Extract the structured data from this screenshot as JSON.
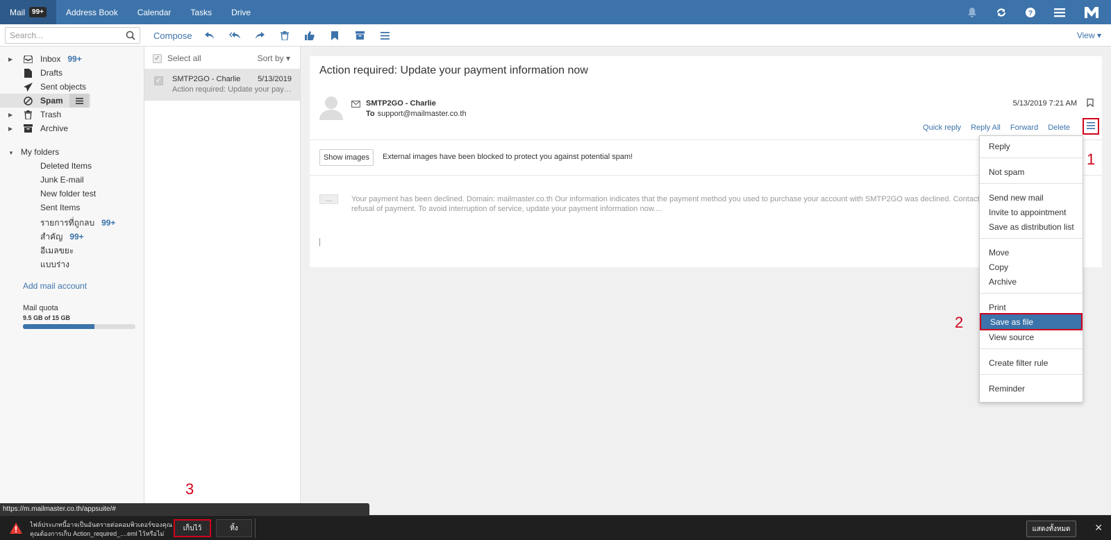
{
  "topbar": {
    "apps": [
      {
        "label": "Mail",
        "badge": "99+",
        "active": true
      },
      {
        "label": "Address Book"
      },
      {
        "label": "Calendar"
      },
      {
        "label": "Tasks"
      },
      {
        "label": "Drive"
      }
    ],
    "icons": [
      "bell-icon",
      "refresh-icon",
      "help-icon",
      "menu-icon",
      "logo-icon"
    ]
  },
  "toolbar": {
    "search_placeholder": "Search...",
    "compose": "Compose",
    "icons": [
      "reply-icon",
      "reply-all-icon",
      "forward-icon",
      "delete-icon",
      "thumbs-up-icon",
      "flag-icon",
      "archive-icon",
      "more-icon"
    ],
    "view": "View"
  },
  "sidebar": {
    "folders": [
      {
        "label": "Inbox",
        "count": "99+",
        "icon": "inbox-icon",
        "arrow": true
      },
      {
        "label": "Drafts",
        "icon": "draft-icon"
      },
      {
        "label": "Sent objects",
        "icon": "send-icon"
      },
      {
        "label": "Spam",
        "icon": "spam-icon",
        "selected": true
      },
      {
        "label": "Trash",
        "icon": "trash-icon",
        "arrow": true
      },
      {
        "label": "Archive",
        "icon": "archive-icon",
        "arrow": true
      }
    ],
    "my_folders_label": "My folders",
    "subfolders": [
      {
        "label": "Deleted Items"
      },
      {
        "label": "Junk E-mail"
      },
      {
        "label": "New folder test"
      },
      {
        "label": "Sent Items"
      },
      {
        "label": "รายการที่ถูกลบ",
        "count": "99+"
      },
      {
        "label": "สำคัญ",
        "count": "99+"
      },
      {
        "label": "อีเมลขยะ"
      },
      {
        "label": "แบบร่าง"
      }
    ],
    "add_account": "Add mail account",
    "quota_label": "Mail quota",
    "quota_value": "9.5 GB of 15 GB",
    "quota_fraction": 0.633
  },
  "list": {
    "select_all": "Select all",
    "sort_by": "Sort by",
    "items": [
      {
        "from": "SMTP2GO - Charlie",
        "date": "5/13/2019",
        "subject": "Action required: Update your pay…"
      }
    ]
  },
  "reader": {
    "subject": "Action required: Update your payment information now",
    "from_name": "SMTP2GO - Charlie",
    "to_label": "To",
    "to_address": "support@mailmaster.co.th",
    "date": "5/13/2019 7:21 AM",
    "actions": [
      "Quick reply",
      "Reply All",
      "Forward",
      "Delete"
    ],
    "show_images": "Show images",
    "blocked_notice": "External images have been blocked to protect you against potential spam!",
    "ellipsis": "....",
    "preview_line1": "Your payment has been declined. Domain: mailmaster.co.th Our information indicates that the payment method you used to purchase your account with SMTP2GO was declined. Contact yo",
    "preview_line2": "refusal of payment. To avoid interruption of service, update your payment information now...."
  },
  "menu": {
    "items": [
      {
        "label": "Reply"
      },
      {
        "label": "Not spam"
      },
      {
        "label": "Send new mail"
      },
      {
        "label": "Invite to appointment"
      },
      {
        "label": "Save as distribution list"
      },
      {
        "label": "Move"
      },
      {
        "label": "Copy"
      },
      {
        "label": "Archive"
      },
      {
        "label": "Print"
      },
      {
        "label": "Save as file",
        "highlighted": true
      },
      {
        "label": "View source"
      },
      {
        "label": "Create filter rule"
      },
      {
        "label": "Reminder"
      }
    ]
  },
  "annotations": {
    "one": "1",
    "two": "2",
    "three": "3"
  },
  "status_url": "https://m.mailmaster.co.th/appsuite/#",
  "download_bar": {
    "line1": "ไฟล์ประเภทนี้อาจเป็นอันตรายต่อคอมพิวเตอร์ของคุณ",
    "line2": "คุณต้องการเก็บ Action_required_....eml ไว้หรือไม่",
    "keep": "เก็บไว้",
    "discard": "ทิ้ง",
    "show_all": "แสดงทั้งหมด",
    "close": "✕"
  },
  "colors": {
    "accent": "#3c73aa",
    "highlight_red": "#d0021b",
    "download_bar": "#1f1f1f"
  }
}
